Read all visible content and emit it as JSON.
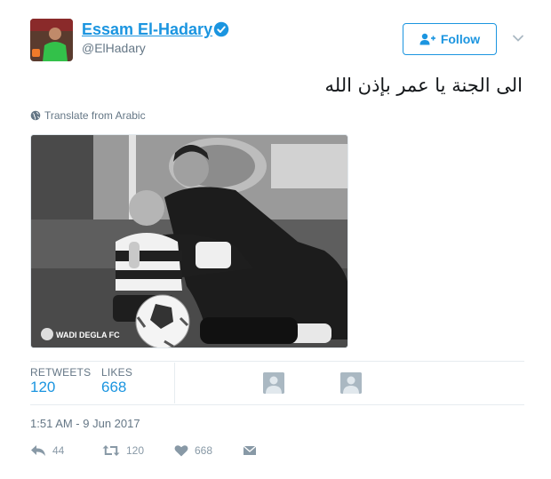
{
  "author": {
    "name": "Essam El-Hadary",
    "handle": "@ElHadary",
    "verified": true
  },
  "follow_button": {
    "label": "Follow",
    "icon": "add-user-icon"
  },
  "tweet": {
    "text": "الى الجنة يا عمر بإذن الله",
    "translate_label": "Translate from Arabic",
    "photo_watermark": "WADI DEGLA FC",
    "timestamp": "1:51 AM - 9 Jun 2017"
  },
  "stats": {
    "retweets_label": "RETWEETS",
    "retweets_value": "120",
    "likes_label": "LIKES",
    "likes_value": "668"
  },
  "actions": {
    "reply_count": "44",
    "retweet_count": "120",
    "like_count": "668"
  },
  "colors": {
    "accent": "#1b95e0",
    "muted": "#657786",
    "icon_gray": "#8899a6"
  }
}
